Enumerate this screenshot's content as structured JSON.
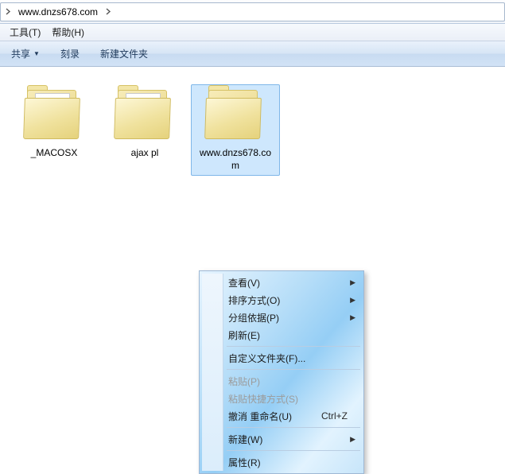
{
  "breadcrumb": {
    "location": "www.dnzs678.com"
  },
  "menubar": {
    "tools": "工具(T)",
    "help": "帮助(H)"
  },
  "toolbar": {
    "share": "共享",
    "burn": "刻录",
    "new_folder": "新建文件夹"
  },
  "items": [
    {
      "name": "_MACOSX",
      "type": "folder-doc"
    },
    {
      "name": "ajax pl",
      "type": "folder-ie"
    },
    {
      "name": "www.dnzs678.com",
      "type": "folder"
    }
  ],
  "context_menu": {
    "view": "查看(V)",
    "sort_by": "排序方式(O)",
    "group_by": "分组依据(P)",
    "refresh": "刷新(E)",
    "customize": "自定义文件夹(F)...",
    "paste": "粘贴(P)",
    "paste_shortcut": "粘贴快捷方式(S)",
    "undo": "撤消 重命名(U)",
    "undo_key": "Ctrl+Z",
    "new": "新建(W)",
    "properties": "属性(R)"
  }
}
